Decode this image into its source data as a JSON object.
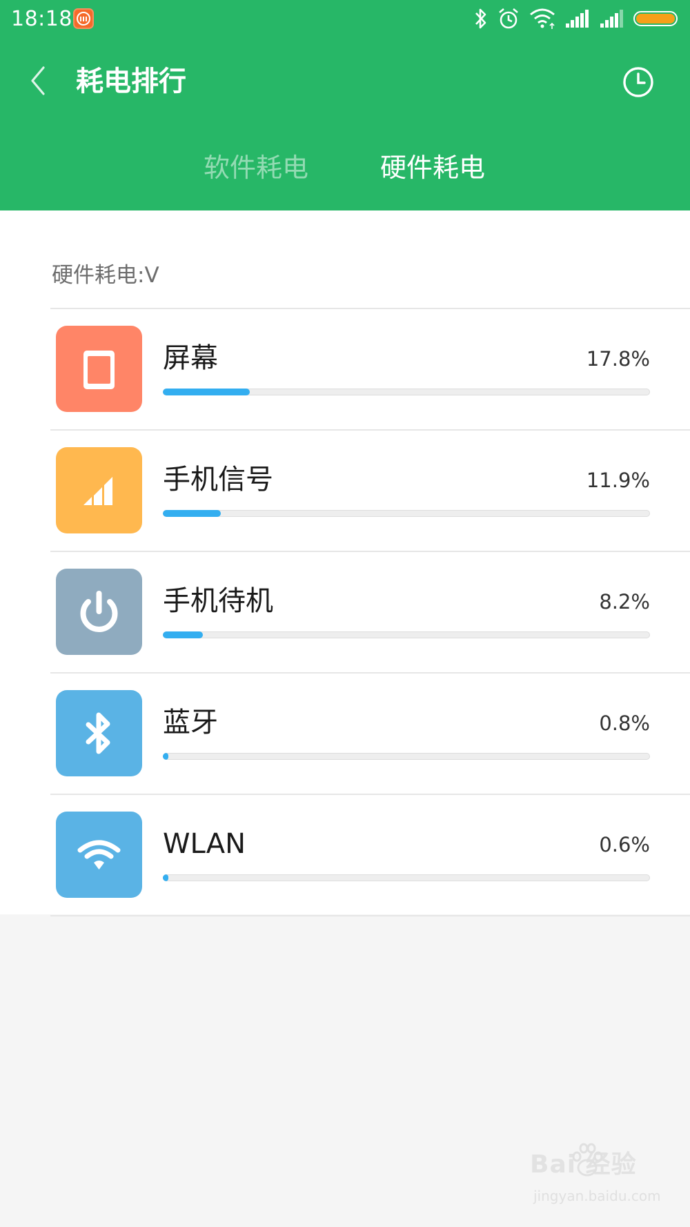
{
  "status_bar": {
    "time": "18:18",
    "battery_color": "#f6a01a"
  },
  "header": {
    "title": "耗电排行",
    "back_icon": "back-chevron-icon",
    "history_icon": "clock-icon",
    "bg_color": "#27b767"
  },
  "tabs": [
    {
      "label": "软件耗电",
      "active": false
    },
    {
      "label": "硬件耗电",
      "active": true
    }
  ],
  "section": {
    "label": "硬件耗电:V"
  },
  "items": [
    {
      "name": "屏幕",
      "percent": "17.8%",
      "value": 17.8,
      "icon": "screen-icon",
      "color": "#ff8567"
    },
    {
      "name": "手机信号",
      "percent": "11.9%",
      "value": 11.9,
      "icon": "signal-icon",
      "color": "#ffb84f"
    },
    {
      "name": "手机待机",
      "percent": "8.2%",
      "value": 8.2,
      "icon": "power-icon",
      "color": "#8fabbf"
    },
    {
      "name": "蓝牙",
      "percent": "0.8%",
      "value": 0.8,
      "icon": "bluetooth-icon",
      "color": "#5ab3e5"
    },
    {
      "name": "WLAN",
      "percent": "0.6%",
      "value": 0.6,
      "icon": "wifi-icon",
      "color": "#5ab3e5"
    }
  ],
  "bar_color": "#33aef0",
  "watermark": {
    "logo": "Bai  经验",
    "url": "jingyan.baidu.com"
  }
}
